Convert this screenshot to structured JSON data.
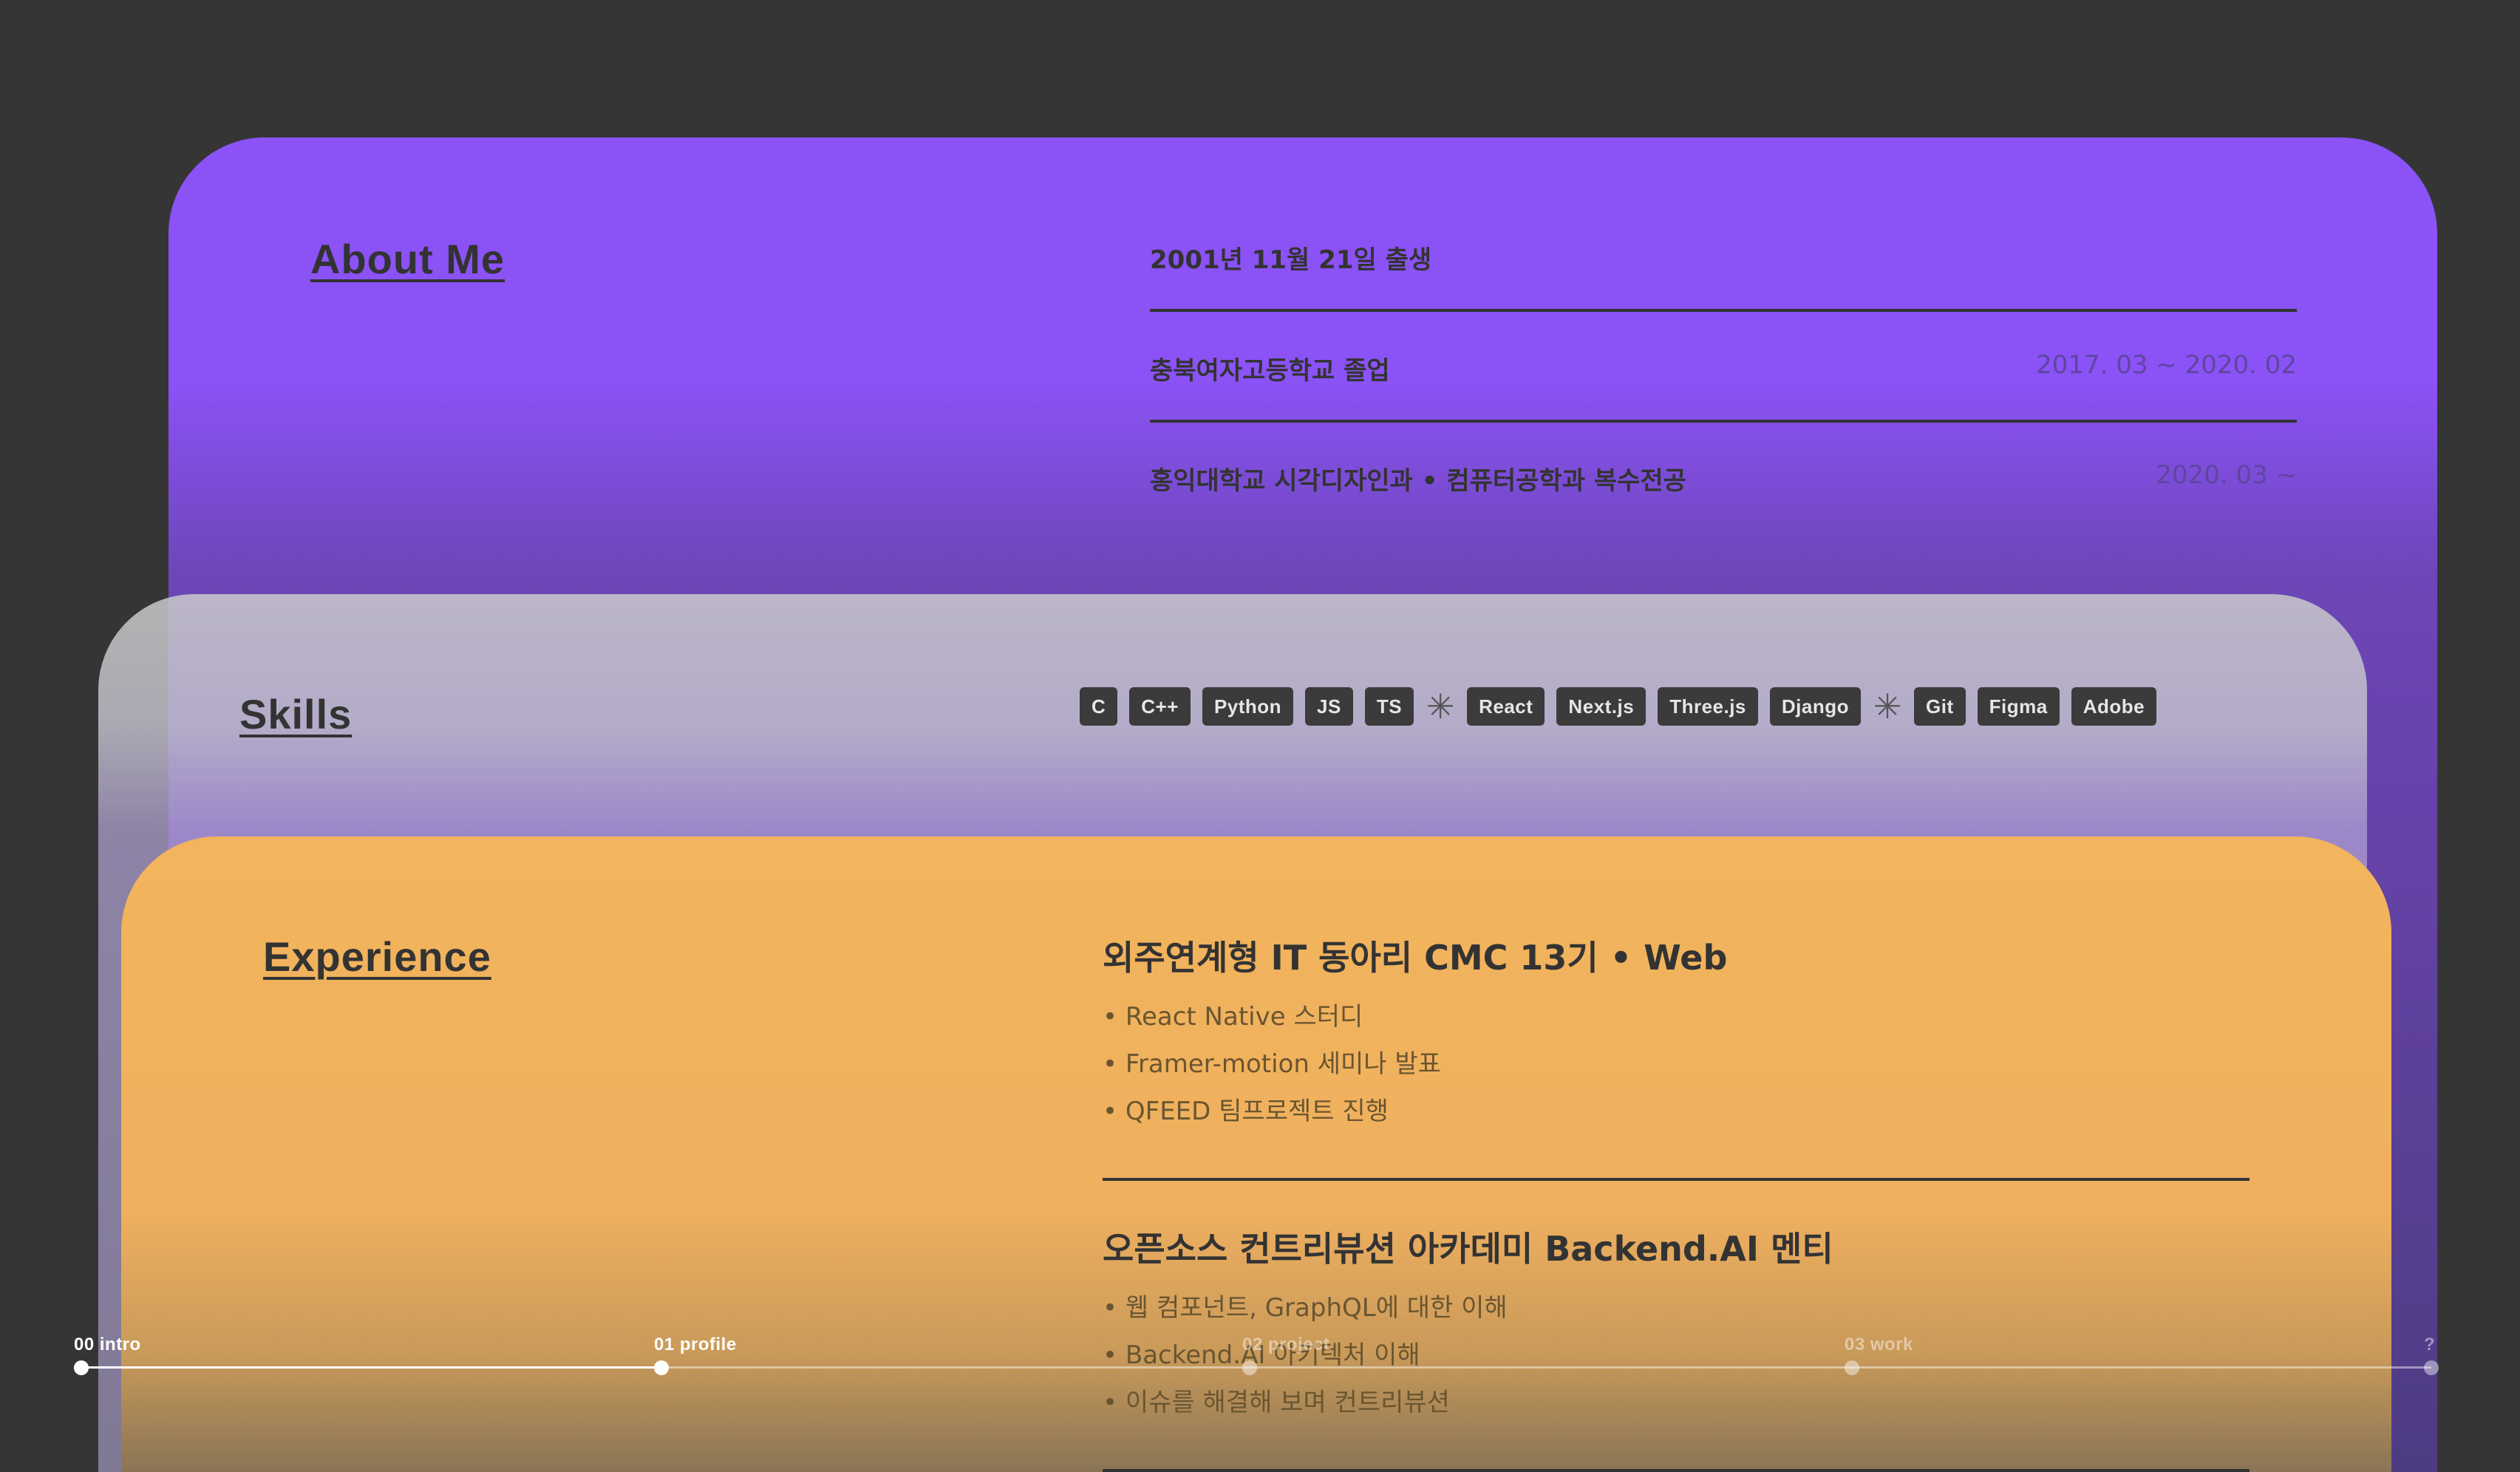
{
  "about": {
    "title": "About Me",
    "rows": [
      {
        "text": "2001년 11월 21일 출생",
        "date": ""
      },
      {
        "text": "충북여자고등학교 졸업",
        "date": "2017. 03 ~ 2020. 02"
      },
      {
        "text": "홍익대학교 시각디자인과 • 컴퓨터공학과 복수전공",
        "date": "2020. 03 ~"
      }
    ]
  },
  "skills": {
    "title": "Skills",
    "groups": [
      [
        "C",
        "C++",
        "Python",
        "JS",
        "TS"
      ],
      [
        "React",
        "Next.js",
        "Three.js",
        "Django"
      ],
      [
        "Git",
        "Figma",
        "Adobe"
      ]
    ],
    "separator": "✳"
  },
  "experience": {
    "title": "Experience",
    "items": [
      {
        "title": "외주연계형 IT 동아리 CMC 13기 • Web",
        "bullets": [
          "React Native 스터디",
          "Framer-motion 세미나 발표",
          "QFEED 팀프로젝트 진행"
        ]
      },
      {
        "title": "오픈소스 컨트리뷰션 아카데미 Backend.AI 멘티",
        "bullets": [
          "웹 컴포넌트, GraphQL에 대한 이해",
          "Backend.AI 아키텍처 이해",
          "이슈를 해결해 보며 컨트리뷰션"
        ]
      }
    ]
  },
  "timeline": {
    "items": [
      {
        "label": "00 intro",
        "state": "done"
      },
      {
        "label": "01 profile",
        "state": "current"
      },
      {
        "label": "02 project",
        "state": "upcoming"
      },
      {
        "label": "03 work",
        "state": "upcoming"
      },
      {
        "label": "?",
        "state": "upcoming"
      }
    ]
  },
  "colors": {
    "about_bg": "#8b52f6",
    "skills_bg": "#c6bfd9",
    "experience_bg": "#f2b45c",
    "page_bg": "#353535",
    "chip_bg": "#3b3b3b"
  }
}
